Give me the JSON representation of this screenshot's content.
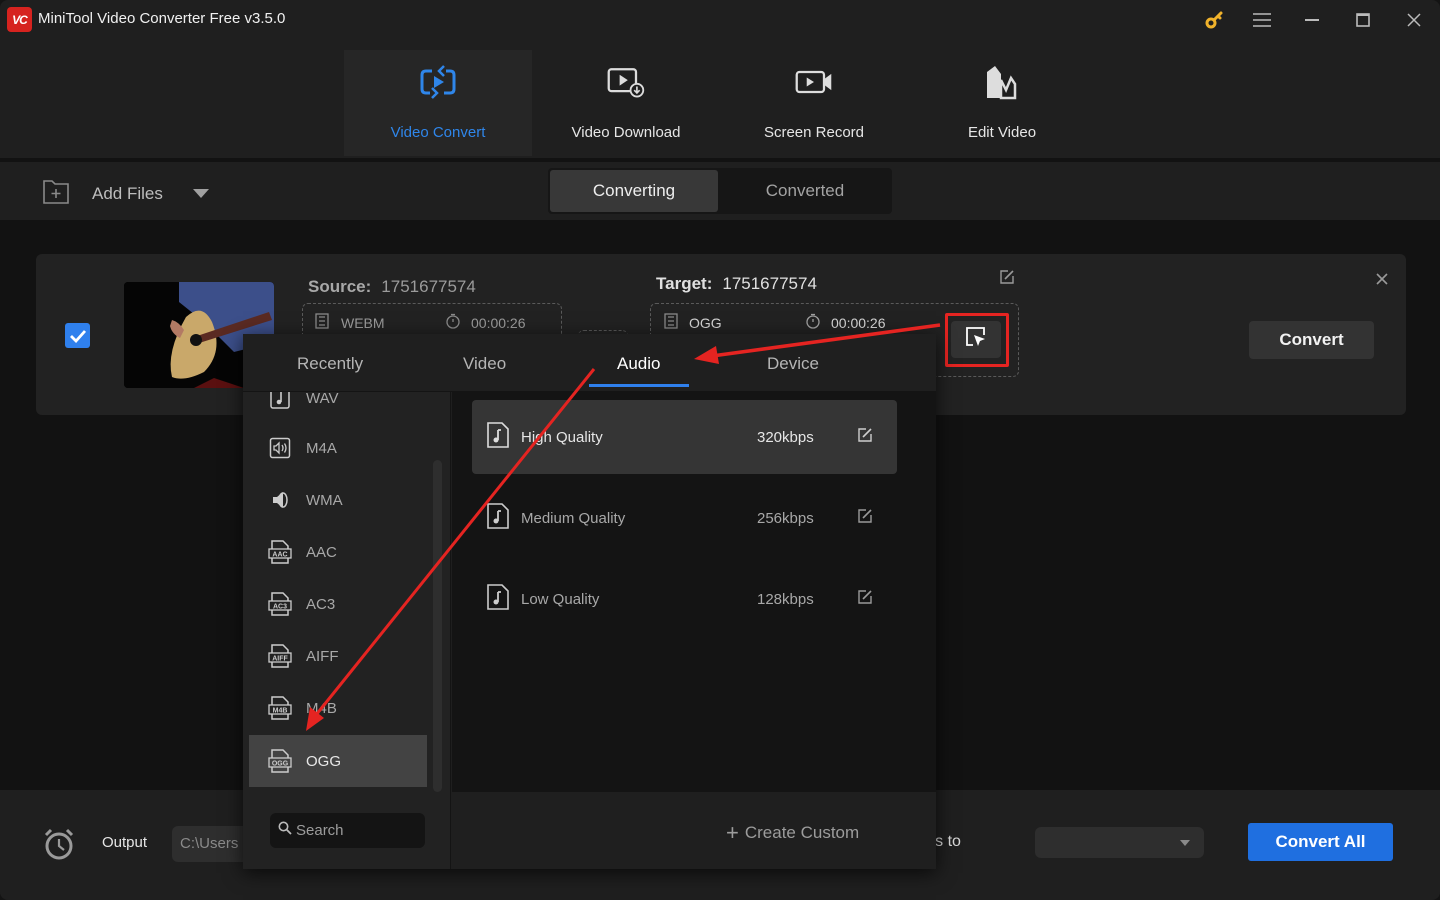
{
  "app": {
    "title": "MiniTool Video Converter Free v3.5.0",
    "logo_text": "VC",
    "accent_color": "#2f86ea",
    "key_icon_color": "#f0b22b"
  },
  "window_controls": [
    "key-icon",
    "menu-icon",
    "minimize-icon",
    "maximize-icon",
    "close-icon"
  ],
  "modules": [
    {
      "label": "Video Convert",
      "icon": "video-convert-icon",
      "active": true
    },
    {
      "label": "Video Download",
      "icon": "video-download-icon",
      "active": false
    },
    {
      "label": "Screen Record",
      "icon": "screen-record-icon",
      "active": false
    },
    {
      "label": "Edit Video",
      "icon": "edit-video-icon",
      "active": false
    }
  ],
  "toolbar": {
    "add_files_label": "Add Files",
    "tabs": [
      {
        "label": "Converting",
        "active": true
      },
      {
        "label": "Converted",
        "active": false
      }
    ]
  },
  "file": {
    "checked": true,
    "source_label": "Source:",
    "source_name": "1751677574",
    "source_format": "WEBM",
    "source_duration": "00:00:26",
    "target_label": "Target:",
    "target_name": "1751677574",
    "target_format": "OGG",
    "target_duration": "00:00:26",
    "convert_label": "Convert"
  },
  "format_popup": {
    "tabs": [
      {
        "label": "Recently",
        "active": false
      },
      {
        "label": "Video",
        "active": false
      },
      {
        "label": "Audio",
        "active": true
      },
      {
        "label": "Device",
        "active": false
      }
    ],
    "formats": [
      {
        "name": "WAV",
        "icon": "wav-icon",
        "selected": false
      },
      {
        "name": "M4A",
        "icon": "m4a-icon",
        "selected": false
      },
      {
        "name": "WMA",
        "icon": "wma-icon",
        "selected": false
      },
      {
        "name": "AAC",
        "icon": "aac-icon",
        "selected": false
      },
      {
        "name": "AC3",
        "icon": "ac3-icon",
        "selected": false
      },
      {
        "name": "AIFF",
        "icon": "aiff-icon",
        "selected": false
      },
      {
        "name": "M4B",
        "icon": "m4b-icon",
        "selected": false
      },
      {
        "name": "OGG",
        "icon": "ogg-icon",
        "selected": true
      }
    ],
    "qualities": [
      {
        "name": "High Quality",
        "bitrate": "320kbps",
        "selected": true
      },
      {
        "name": "Medium Quality",
        "bitrate": "256kbps",
        "selected": false
      },
      {
        "name": "Low Quality",
        "bitrate": "128kbps",
        "selected": false
      }
    ],
    "search_placeholder": "Search",
    "create_custom_label": "Create Custom"
  },
  "bottom": {
    "output_label": "Output",
    "output_path": "C:\\Users",
    "convert_all_to_label": "Convert all files to",
    "convert_all_to_visible": "rt all files to",
    "convert_all_to_value": "",
    "convert_all_button": "Convert All"
  },
  "annotations": {
    "color": "#e52421",
    "highlight": "format-settings-button",
    "arrows": [
      "format-button-to-audio-tab",
      "audio-tab-to-ogg-item"
    ]
  }
}
